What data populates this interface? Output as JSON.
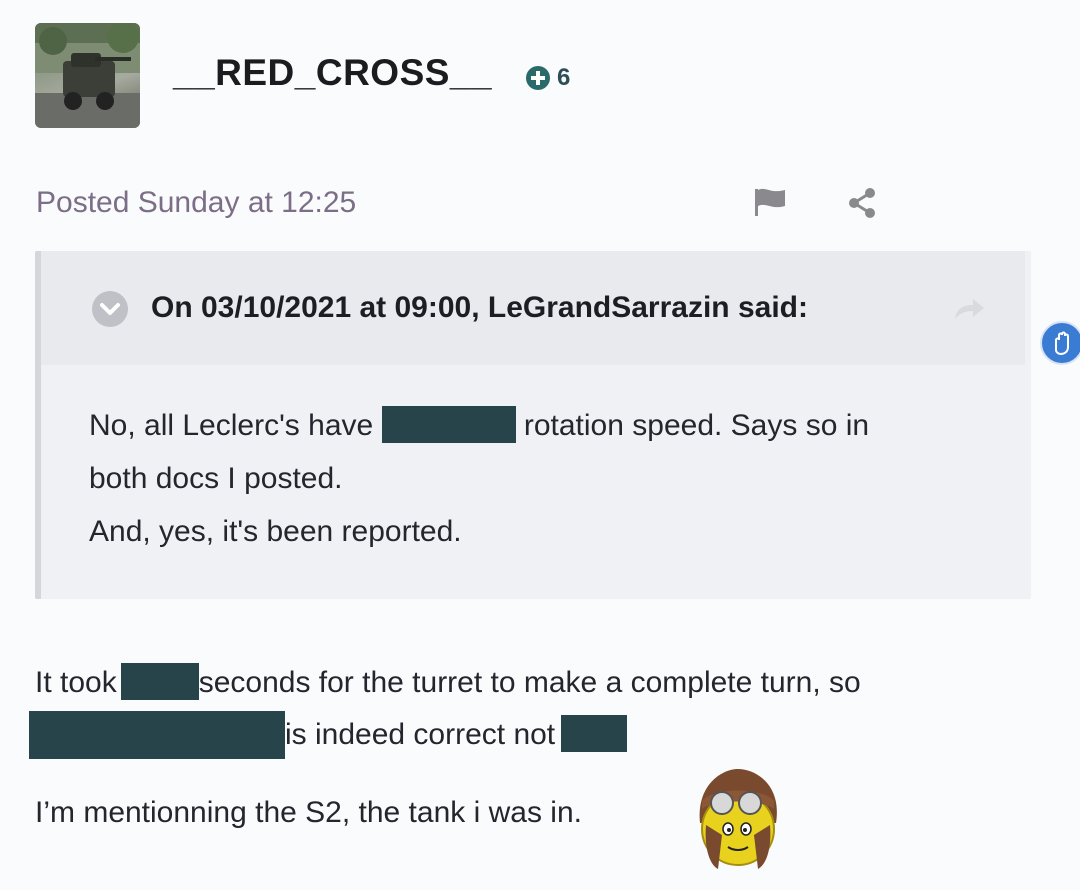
{
  "post": {
    "author": {
      "username": "__RED_CROSS__",
      "reputation": "6",
      "avatar_icon": "tank-avatar-icon"
    },
    "posted_text": "Posted Sunday at 12:25",
    "actions": {
      "report_icon": "flag-icon",
      "share_icon": "share-icon"
    },
    "quote": {
      "cite": "On 03/10/2021 at 09:00, LeGrandSarrazin said:",
      "line1_before": "No, all Leclerc's have ",
      "line1_after": " rotation speed. Says so in",
      "line2": "both docs I posted.",
      "line3": "And, yes, it's been reported."
    },
    "body": {
      "line1_before": "It took",
      "line1_after": "seconds for the turret to make a complete turn, so",
      "line2_middle": "is indeed correct not",
      "line3": "I’m mentionning the S2, the tank i was in."
    },
    "emoji": "aviator-smiley-icon"
  },
  "watermark": "",
  "colors": {
    "redaction": "#28444b",
    "reputation": "#2b6a6a",
    "side_button": "#3a7bd4"
  }
}
